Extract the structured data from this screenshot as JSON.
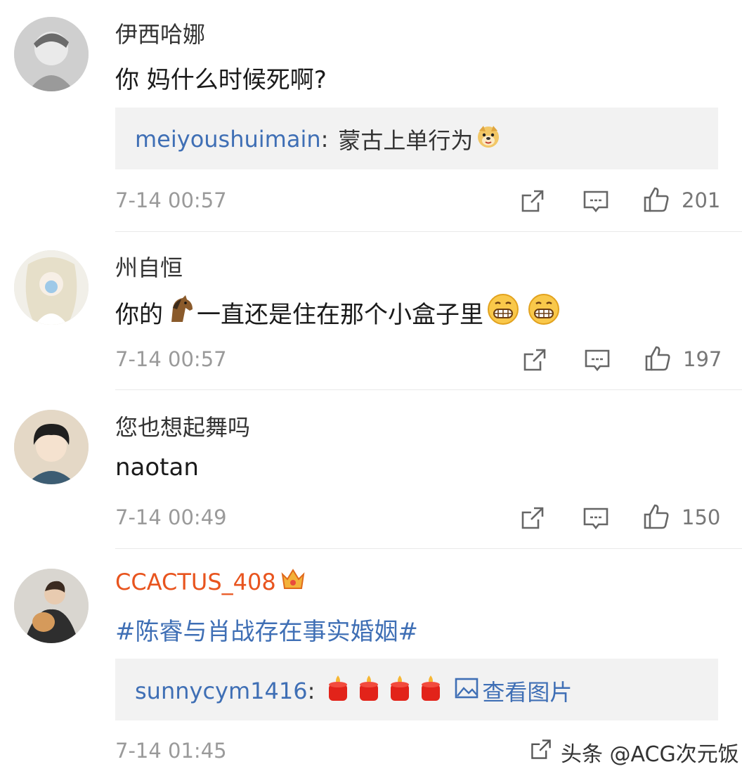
{
  "comments": [
    {
      "username": "伊西哈娜",
      "text": "你 妈什么时候死啊?",
      "reply": {
        "name": "meiyoushuimain",
        "sep": ":",
        "text": "蒙古上单行为"
      },
      "time": "7-14 00:57",
      "likes": "201"
    },
    {
      "username": "州自恒",
      "text_before": "你的",
      "text_after": "一直还是住在那个小盒子里",
      "time": "7-14 00:57",
      "likes": "197"
    },
    {
      "username": "您也想起舞吗",
      "text": "naotan",
      "time": "7-14 00:49",
      "likes": "150"
    },
    {
      "username": "CCACTUS_408",
      "text": "#陈睿与肖战存在事实婚姻#",
      "reply": {
        "name": "sunnycym1416",
        "sep": ":",
        "link": "查看图片"
      },
      "time": "7-14 01:45"
    }
  ],
  "watermark": "头条 @ACG次元饭",
  "colors": {
    "link_blue": "#3f6fb5",
    "vip_orange": "#e8541e",
    "meta_gray": "#9a9a9a"
  }
}
